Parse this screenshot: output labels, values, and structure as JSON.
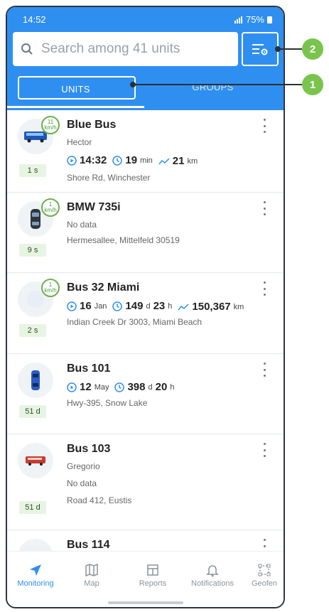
{
  "status": {
    "time": "14:52",
    "battery": "75%"
  },
  "search": {
    "placeholder": "Search among 41 units"
  },
  "tabs": [
    {
      "label": "UNITS"
    },
    {
      "label": "GROUPS"
    }
  ],
  "units": [
    {
      "name": "Blue Bus",
      "driver": "Hector",
      "ago": "1 s",
      "speed": "11",
      "speed_unit": "km/h",
      "time": "14:32",
      "dur_val": "19",
      "dur_unit": "min",
      "dist_val": "21",
      "dist_unit": "km",
      "address": "Shore Rd, Winchester"
    },
    {
      "name": "BMW 735i",
      "status_text": "No data",
      "ago": "9 s",
      "speed": "1",
      "speed_unit": "km/h",
      "address": "Hermesallee, Mittelfeld 30519"
    },
    {
      "name": "Bus 32 Miami",
      "ago": "2 s",
      "speed": "1",
      "speed_unit": "km/h",
      "date_val": "16",
      "date_unit": "Jan",
      "dur_d": "149",
      "dur_d_unit": "d",
      "dur_h": "23",
      "dur_h_unit": "h",
      "dist_val": "150,367",
      "dist_unit": "km",
      "address": "Indian Creek Dr 3003, Miami Beach"
    },
    {
      "name": "Bus 101",
      "ago": "51 d",
      "date_val": "12",
      "date_unit": "May",
      "dur_d": "398",
      "dur_d_unit": "d",
      "dur_h": "20",
      "dur_h_unit": "h",
      "address": "Hwy-395, Snow Lake"
    },
    {
      "name": "Bus 103",
      "driver": "Gregorio",
      "status_text": "No data",
      "ago": "51 d",
      "address": "Road 412, Eustis"
    },
    {
      "name": "Bus 114"
    }
  ],
  "nav": [
    {
      "label": "Monitoring",
      "icon": "navigation-arrow-icon"
    },
    {
      "label": "Map",
      "icon": "map-icon"
    },
    {
      "label": "Reports",
      "icon": "reports-icon"
    },
    {
      "label": "Notifications",
      "icon": "bell-icon"
    },
    {
      "label": "Geofen",
      "icon": "geofence-icon"
    }
  ],
  "callouts": [
    "1",
    "2"
  ],
  "colors": {
    "accent": "#2f8ff0",
    "callout": "#79c44d"
  }
}
